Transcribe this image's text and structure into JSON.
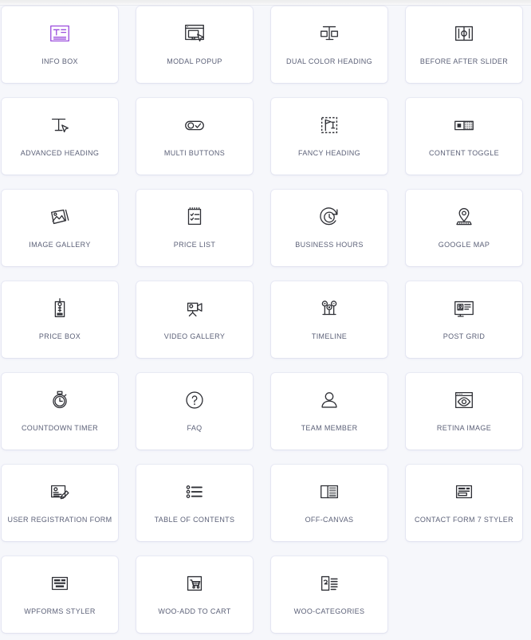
{
  "panel": {
    "name": "widgets-panel",
    "accent_color": "#9b4ddd",
    "label_color": "#5c6178",
    "icon_color": "#2f3036",
    "card_background": "#ffffff",
    "panel_background": "#f6f7fb"
  },
  "widgets": [
    {
      "label": "INFO BOX",
      "icon": "info-box-icon",
      "active": true
    },
    {
      "label": "MODAL POPUP",
      "icon": "modal-popup-icon",
      "active": false
    },
    {
      "label": "DUAL COLOR HEADING",
      "icon": "dual-color-heading-icon",
      "active": false
    },
    {
      "label": "BEFORE AFTER SLIDER",
      "icon": "before-after-slider-icon",
      "active": false
    },
    {
      "label": "ADVANCED HEADING",
      "icon": "advanced-heading-icon",
      "active": false
    },
    {
      "label": "MULTI BUTTONS",
      "icon": "multi-buttons-icon",
      "active": false
    },
    {
      "label": "FANCY HEADING",
      "icon": "fancy-heading-icon",
      "active": false
    },
    {
      "label": "CONTENT TOGGLE",
      "icon": "content-toggle-icon",
      "active": false
    },
    {
      "label": "IMAGE GALLERY",
      "icon": "image-gallery-icon",
      "active": false
    },
    {
      "label": "PRICE LIST",
      "icon": "price-list-icon",
      "active": false
    },
    {
      "label": "BUSINESS HOURS",
      "icon": "business-hours-icon",
      "active": false
    },
    {
      "label": "GOOGLE MAP",
      "icon": "google-map-icon",
      "active": false
    },
    {
      "label": "PRICE BOX",
      "icon": "price-box-icon",
      "active": false
    },
    {
      "label": "VIDEO GALLERY",
      "icon": "video-gallery-icon",
      "active": false
    },
    {
      "label": "TIMELINE",
      "icon": "timeline-icon",
      "active": false
    },
    {
      "label": "POST GRID",
      "icon": "post-grid-icon",
      "active": false
    },
    {
      "label": "COUNTDOWN TIMER",
      "icon": "countdown-timer-icon",
      "active": false
    },
    {
      "label": "FAQ",
      "icon": "faq-icon",
      "active": false
    },
    {
      "label": "TEAM MEMBER",
      "icon": "team-member-icon",
      "active": false
    },
    {
      "label": "RETINA IMAGE",
      "icon": "retina-image-icon",
      "active": false
    },
    {
      "label": "USER REGISTRATION FORM",
      "icon": "user-registration-form-icon",
      "active": false
    },
    {
      "label": "TABLE OF CONTENTS",
      "icon": "table-of-contents-icon",
      "active": false
    },
    {
      "label": "OFF-CANVAS",
      "icon": "off-canvas-icon",
      "active": false
    },
    {
      "label": "CONTACT FORM 7 STYLER",
      "icon": "contact-form-7-styler-icon",
      "active": false
    },
    {
      "label": "WPFORMS STYLER",
      "icon": "wpforms-styler-icon",
      "active": false
    },
    {
      "label": "WOO-ADD TO CART",
      "icon": "woo-add-to-cart-icon",
      "active": false
    },
    {
      "label": "WOO-CATEGORIES",
      "icon": "woo-categories-icon",
      "active": false
    }
  ]
}
